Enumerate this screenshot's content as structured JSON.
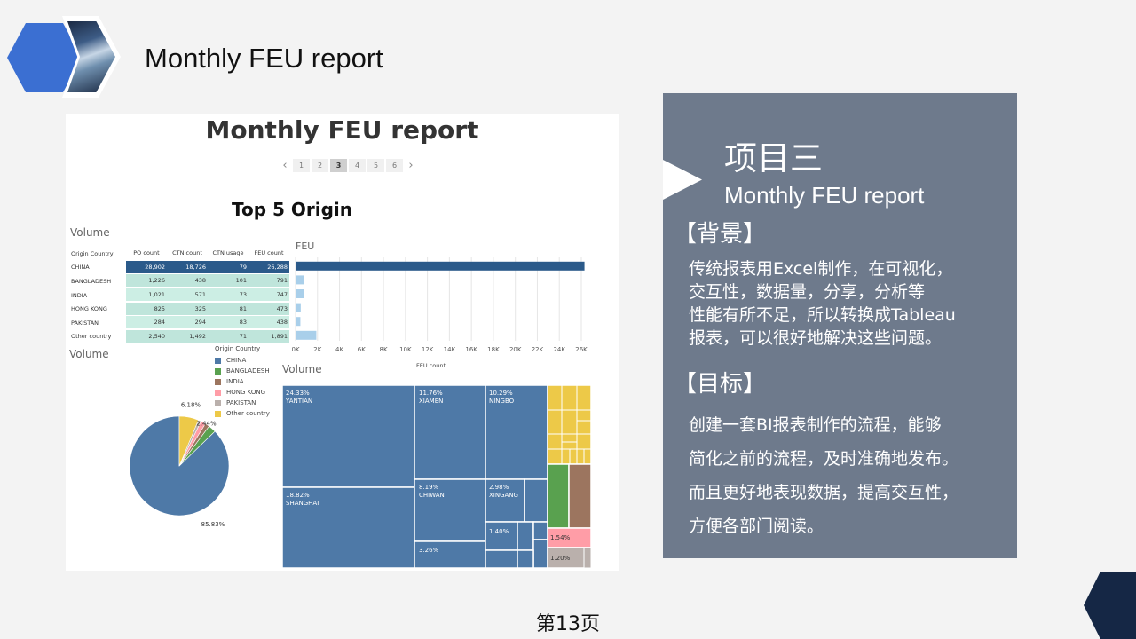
{
  "header": {
    "title": "Monthly FEU report"
  },
  "dashboard": {
    "title": "Monthly FEU report",
    "pager": {
      "prev": "‹",
      "next": "›",
      "pages": [
        "1",
        "2",
        "3",
        "4",
        "5",
        "6"
      ],
      "active_page": "3"
    },
    "section_title": "Top 5 Origin",
    "volume_label": "Volume",
    "table": {
      "columns": [
        "Origin Country",
        "PO count",
        "CTN count",
        "CTN usage",
        "FEU count"
      ],
      "rows": [
        [
          "CHINA",
          "28,902",
          "18,726",
          "79",
          "26,288"
        ],
        [
          "BANGLADESH",
          "1,226",
          "438",
          "101",
          "791"
        ],
        [
          "INDIA",
          "1,021",
          "571",
          "73",
          "747"
        ],
        [
          "HONG KONG",
          "825",
          "325",
          "81",
          "473"
        ],
        [
          "PAKISTAN",
          "284",
          "294",
          "83",
          "438"
        ],
        [
          "Other country",
          "2,540",
          "1,492",
          "71",
          "1,891"
        ]
      ]
    },
    "legend": {
      "title": "Origin Country",
      "items": [
        {
          "label": "CHINA",
          "color": "#4e79a7"
        },
        {
          "label": "BANGLADESH",
          "color": "#59a14f"
        },
        {
          "label": "INDIA",
          "color": "#9c755f"
        },
        {
          "label": "HONG KONG",
          "color": "#ff9da7"
        },
        {
          "label": "PAKISTAN",
          "color": "#bab0ac"
        },
        {
          "label": "Other country",
          "color": "#edc948"
        }
      ]
    },
    "treemap_labels": {
      "yantian": {
        "pct": "24.33%",
        "name": "YANTIAN"
      },
      "xiamen": {
        "pct": "11.76%",
        "name": "XIAMEN"
      },
      "ningbo": {
        "pct": "10.29%",
        "name": "NINGBO"
      },
      "shanghai": {
        "pct": "18.82%",
        "name": "SHANGHAI"
      },
      "chiwan": {
        "pct": "8.19%",
        "name": "CHIWAN"
      },
      "xingang": {
        "pct": "2.98%",
        "name": "XINGANG"
      },
      "small_a": "1.40%",
      "small_b": "3.26%",
      "other_a": "1.54%",
      "other_b": "1.20%"
    }
  },
  "chart_data": [
    {
      "type": "bar",
      "title": "FEU",
      "xlabel": "FEU count",
      "orientation": "horizontal",
      "categories": [
        "CHINA",
        "BANGLADESH",
        "INDIA",
        "HONG KONG",
        "PAKISTAN",
        "Other country"
      ],
      "values": [
        26288,
        791,
        747,
        473,
        438,
        1891
      ],
      "xlim": [
        0,
        26000
      ],
      "ticks": [
        "0K",
        "2K",
        "4K",
        "6K",
        "8K",
        "10K",
        "12K",
        "14K",
        "16K",
        "18K",
        "20K",
        "22K",
        "24K",
        "26K"
      ],
      "colors": {
        "highlight": "#2b5a8a",
        "normal": "#a9cfea"
      }
    },
    {
      "type": "pie",
      "title": "Volume",
      "categories": [
        "CHINA",
        "BANGLADESH",
        "INDIA",
        "HONG KONG",
        "PAKISTAN",
        "Other country"
      ],
      "values": [
        85.83,
        2.44,
        1.4,
        1.6,
        0.9,
        6.18
      ],
      "labels": {
        "CHINA": "85.83%",
        "BANGLADESH": "2.44%",
        "Other country": "6.18%"
      }
    }
  ],
  "panel": {
    "heading": "项目三",
    "subtitle": "Monthly FEU report",
    "background_label": "【背景】",
    "background_lines": [
      "传统报表用Excel制作，在可视化，",
      "交互性，数据量，分享，分析等",
      "性能有所不足，所以转换成Tableau",
      "报表，可以很好地解决这些问题。"
    ],
    "goal_label": "【目标】",
    "goal_lines": [
      "创建一套BI报表制作的流程，能够",
      "简化之前的流程，及时准确地发布。",
      "而且更好地表现数据，提高交互性，",
      "方便各部门阅读。"
    ]
  },
  "page_number": "第13页",
  "colors": {
    "panel_bg": "#6e7a8c",
    "accent_blue": "#3b6fd2",
    "corner_navy": "#152745",
    "treemap_blue": "#4e79a7"
  }
}
